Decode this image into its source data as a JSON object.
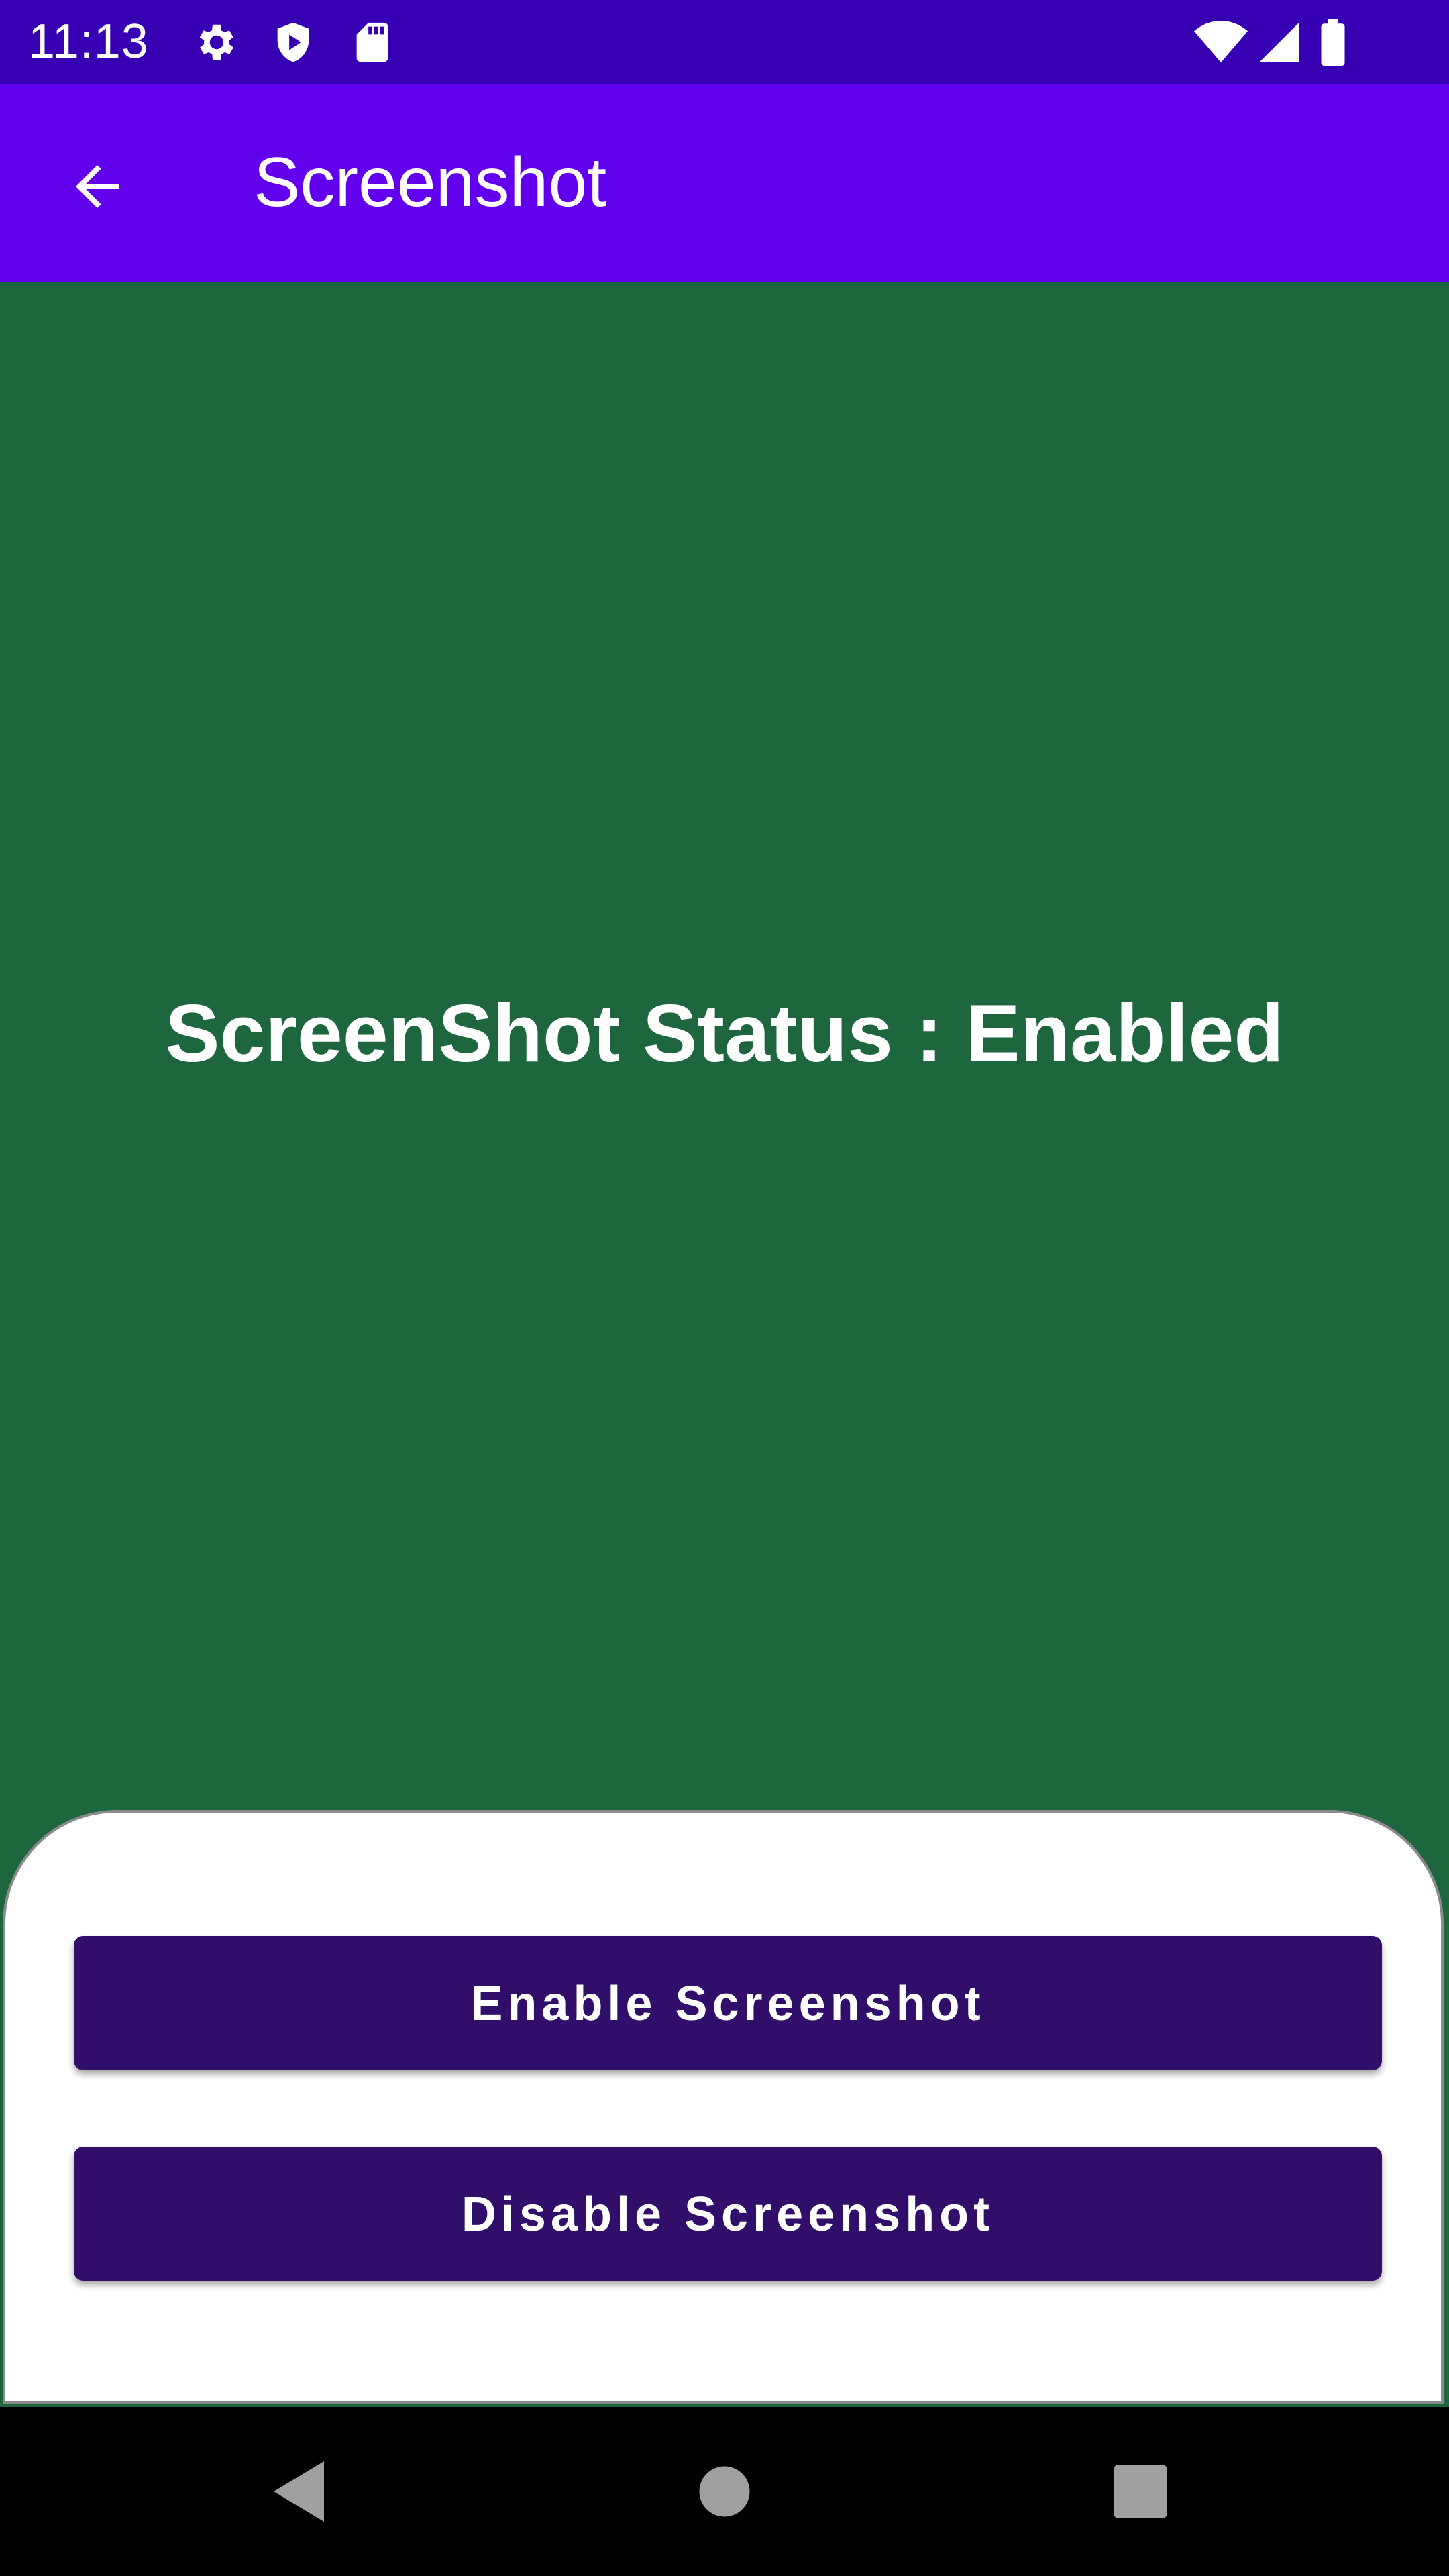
{
  "status_bar": {
    "time": "11:13",
    "icons": [
      "settings-icon",
      "shield-icon",
      "sd-card-icon",
      "wifi-icon",
      "signal-icon",
      "battery-icon"
    ]
  },
  "app_bar": {
    "title": "Screenshot",
    "back_icon": "arrow-back-icon"
  },
  "content": {
    "status_text": "ScreenShot Status : Enabled",
    "background_color": "#1E663E"
  },
  "bottom_sheet": {
    "enable_label": "Enable Screenshot",
    "disable_label": "Disable Screenshot",
    "button_color": "#320E6B"
  },
  "nav_bar": {
    "icons": [
      "back-triangle-icon",
      "home-circle-icon",
      "recents-square-icon"
    ]
  },
  "colors": {
    "status_bar": "#3700B3",
    "app_bar": "#6200EE"
  }
}
